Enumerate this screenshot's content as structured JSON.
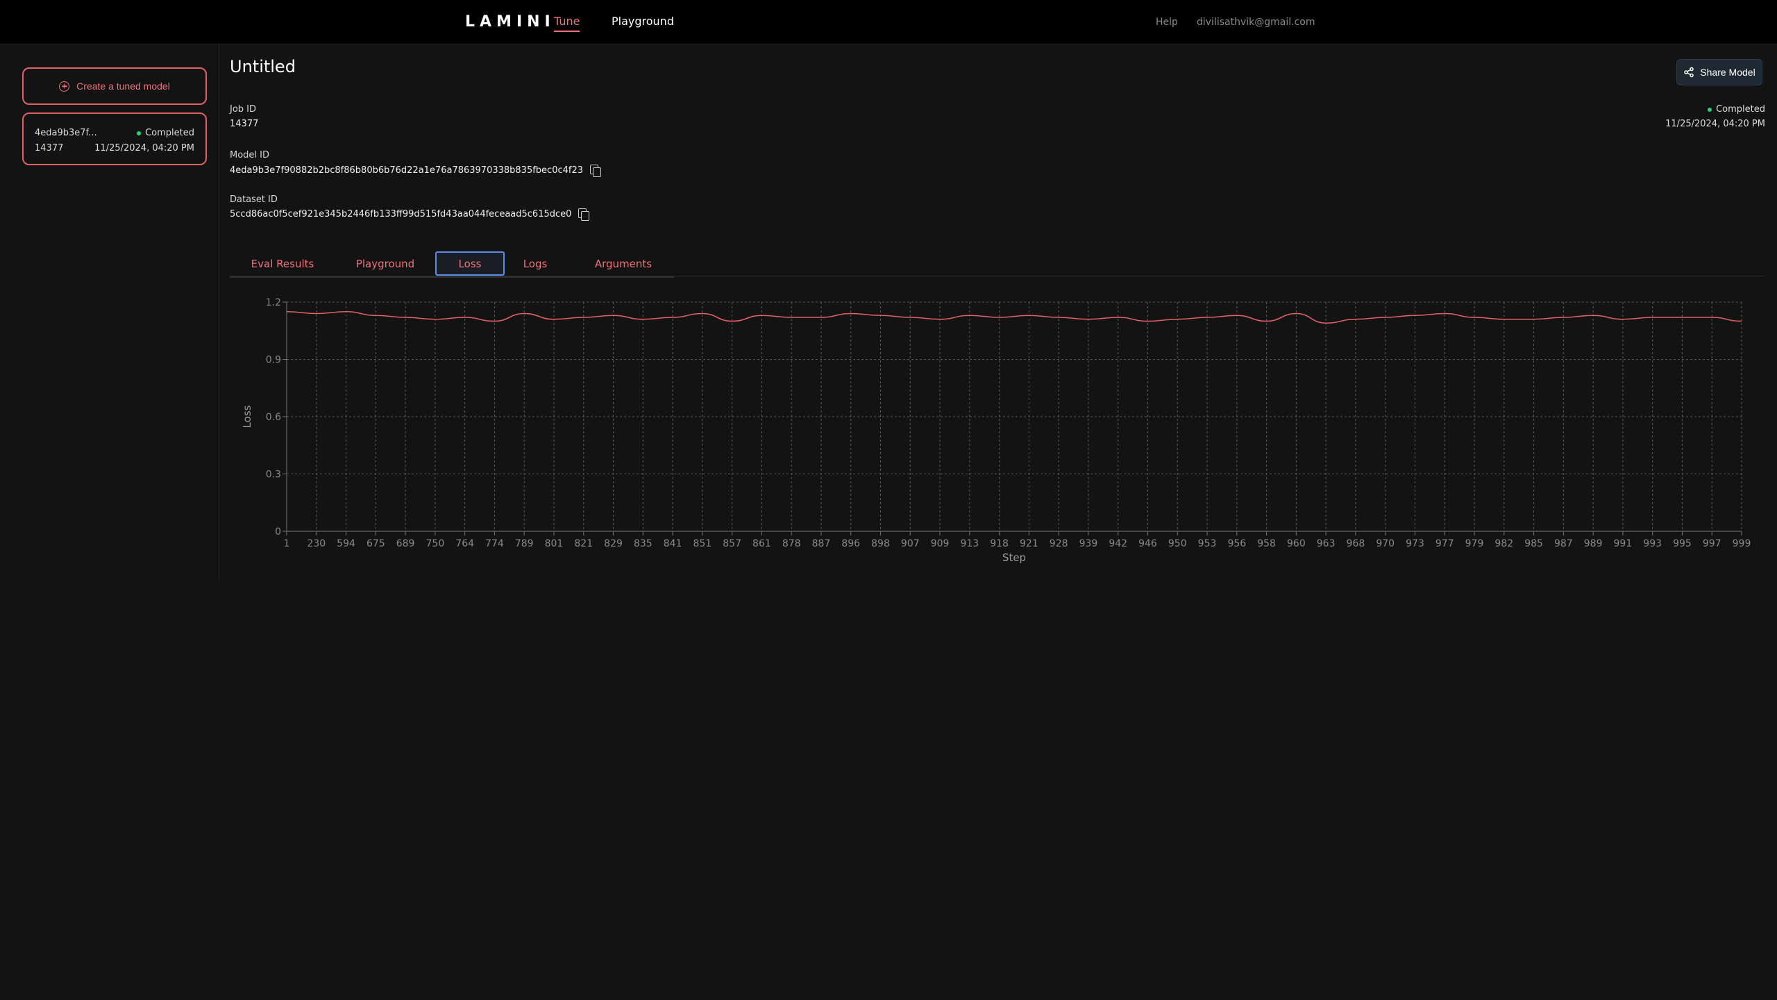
{
  "topbar": {
    "logo": "LAMINI",
    "nav": {
      "tune": "Tune",
      "playground": "Playground"
    },
    "help": "Help",
    "email": "divilisathvik@gmail.com"
  },
  "sidebar": {
    "create_button": "Create a tuned model",
    "jobs": [
      {
        "model_short": "4eda9b3e7f...",
        "status": "Completed",
        "job_id": "14377",
        "date": "11/25/2024, 04:20 PM"
      }
    ]
  },
  "main": {
    "title": "Untitled",
    "share_button": "Share Model",
    "status": "Completed",
    "date": "11/25/2024, 04:20 PM",
    "job_id_label": "Job ID",
    "job_id": "14377",
    "model_id_label": "Model ID",
    "model_id": "4eda9b3e7f90882b2bc8f86b80b6b76d22a1e76a7863970338b835fbec0c4f23",
    "dataset_id_label": "Dataset ID",
    "dataset_id": "5ccd86ac0f5cef921e345b2446fb133ff99d515fd43aa044feceaad5c615dce0",
    "tabs": [
      "Eval Results",
      "Playground",
      "Loss",
      "Logs",
      "Arguments"
    ],
    "active_tab": "Loss"
  },
  "colors": {
    "accent": "#f0727a",
    "status_ok": "#28d07a",
    "line": "#e0616a",
    "focus": "#5b8ce8"
  },
  "chart_data": {
    "type": "line",
    "xlabel": "Step",
    "ylabel": "Loss",
    "ylim": [
      0,
      1.2
    ],
    "yticks": [
      0,
      0.3,
      0.6,
      0.9,
      1.2
    ],
    "grid": true,
    "categories": [
      "1",
      "230",
      "594",
      "675",
      "689",
      "750",
      "764",
      "774",
      "789",
      "801",
      "821",
      "829",
      "835",
      "841",
      "851",
      "857",
      "861",
      "878",
      "887",
      "896",
      "898",
      "907",
      "909",
      "913",
      "918",
      "921",
      "928",
      "939",
      "942",
      "946",
      "950",
      "953",
      "956",
      "958",
      "960",
      "963",
      "968",
      "970",
      "973",
      "977",
      "979",
      "982",
      "985",
      "987",
      "989",
      "991",
      "993",
      "995",
      "997",
      "999"
    ],
    "values": [
      1.15,
      1.14,
      1.15,
      1.13,
      1.12,
      1.11,
      1.12,
      1.1,
      1.14,
      1.11,
      1.12,
      1.13,
      1.11,
      1.12,
      1.14,
      1.1,
      1.13,
      1.12,
      1.12,
      1.14,
      1.13,
      1.12,
      1.11,
      1.13,
      1.12,
      1.13,
      1.12,
      1.11,
      1.12,
      1.1,
      1.11,
      1.12,
      1.13,
      1.1,
      1.14,
      1.09,
      1.11,
      1.12,
      1.13,
      1.14,
      1.12,
      1.11,
      1.11,
      1.12,
      1.13,
      1.11,
      1.12,
      1.12,
      1.12,
      1.1
    ]
  }
}
